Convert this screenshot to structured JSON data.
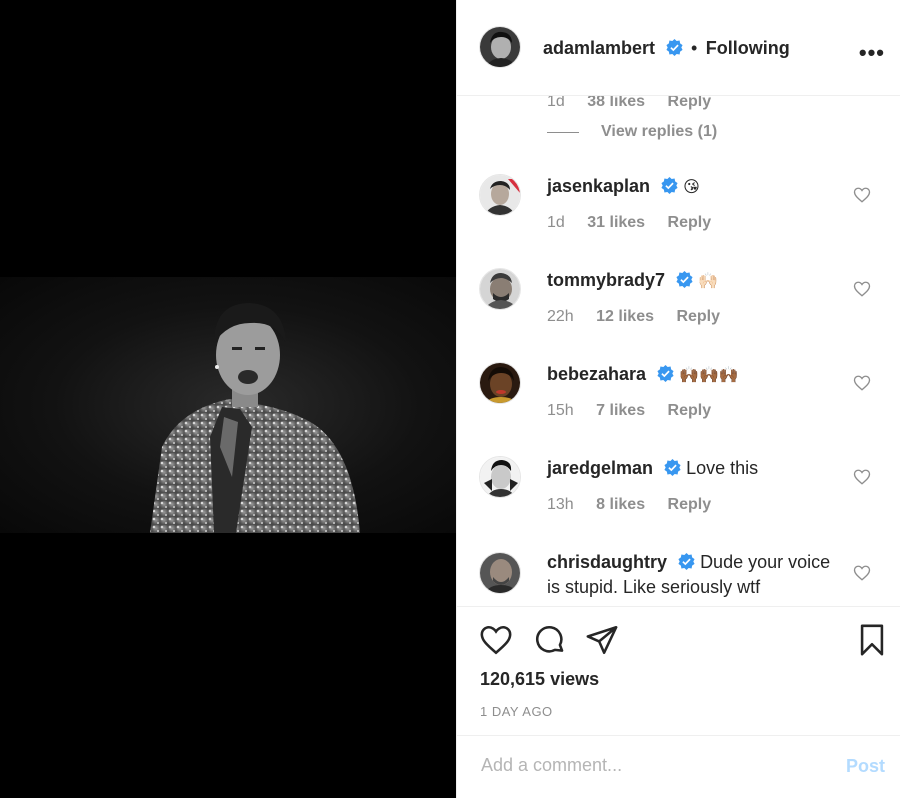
{
  "post": {
    "author": "adamlambert",
    "separator": "•",
    "follow_status": "Following",
    "more_label": "•••"
  },
  "comments": [
    {
      "username": "",
      "text": "",
      "time": "1d",
      "likes": "38 likes",
      "reply": "Reply"
    },
    {
      "username": "jasenkaplan",
      "text": "😘",
      "time": "1d",
      "likes": "31 likes",
      "reply": "Reply"
    },
    {
      "username": "tommybrady7",
      "text": "🙌🏻",
      "time": "22h",
      "likes": "12 likes",
      "reply": "Reply"
    },
    {
      "username": "bebezahara",
      "text": "🙌🏾🙌🏾🙌🏾",
      "time": "15h",
      "likes": "7 likes",
      "reply": "Reply"
    },
    {
      "username": "jaredgelman",
      "text": "Love this",
      "time": "13h",
      "likes": "8 likes",
      "reply": "Reply"
    },
    {
      "username": "chrisdaughtry",
      "text": "Dude your voice is stupid. Like seriously wtf",
      "time": "",
      "likes": "",
      "reply": ""
    }
  ],
  "view_replies": "View replies (1)",
  "stats": {
    "views": "120,615 views",
    "date": "1 DAY AGO"
  },
  "add_comment": {
    "placeholder": "Add a comment...",
    "post_label": "Post"
  },
  "colors": {
    "verified": "#3897f0",
    "post_disabled": "#b3dbff",
    "muted": "#8e8e8e"
  },
  "icons": [
    "heart-icon",
    "comment-icon",
    "share-icon",
    "bookmark-icon",
    "verified-badge-icon",
    "more-options-icon"
  ]
}
